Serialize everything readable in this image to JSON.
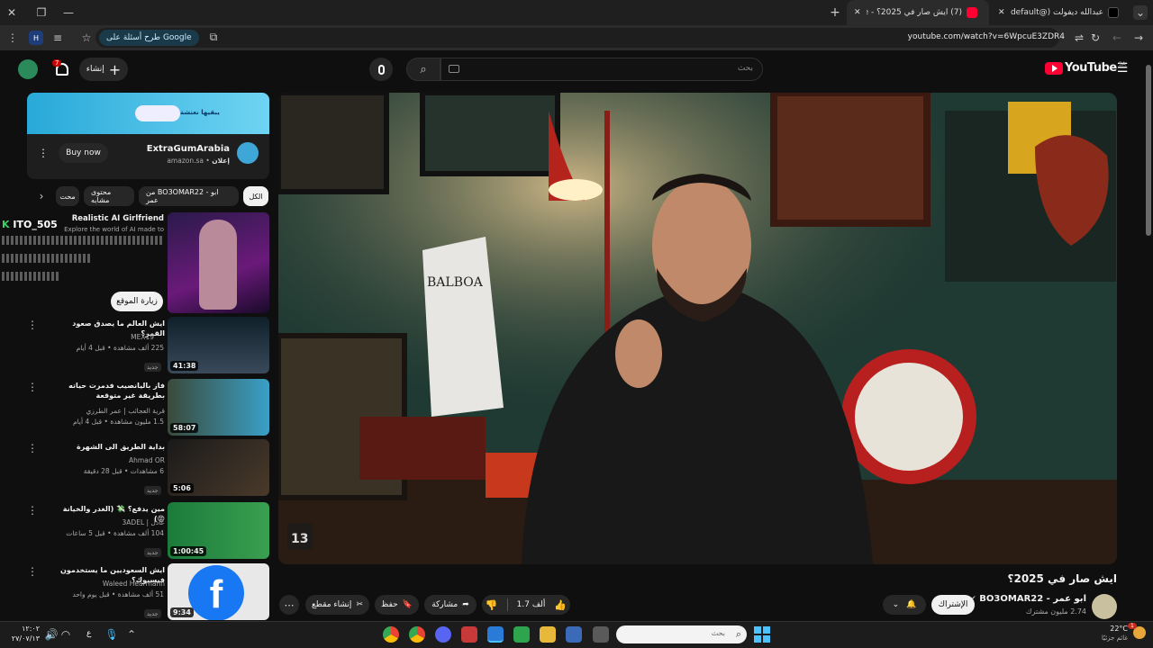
{
  "browser": {
    "tabs": [
      {
        "label": "عبدالله ديفولت (@llah_default"
      },
      {
        "label": "(7) ايش صار في 2025؟ - YouTube"
      }
    ],
    "new_tab": "+",
    "url": "youtube.com/watch?v=6WpcuE3ZDR4",
    "ask_google": "طرح أسئلة على Google",
    "profile_letter": "H"
  },
  "yt": {
    "logo_text": "YouTube",
    "logo_region": "SA",
    "search_placeholder": "بحث",
    "create_label": "إنشاء",
    "notif_count": "7"
  },
  "ad": {
    "brand": "ExtraGumArabia",
    "domain": "amazon.sa",
    "ad_label": "إعلان",
    "buy_label": "Buy now",
    "banner_text": "يبقيها نعنشة"
  },
  "chips": [
    "الكل",
    "من BO3OMAR22 - ابو عمر",
    "محتوى مشابه",
    "محت"
  ],
  "promo": {
    "title": "Realistic AI Girlfriend",
    "desc": "Explore the world of AI made to",
    "code": "ITO_505",
    "visit": "زيارة الموقع"
  },
  "videos": [
    {
      "title": "ايش العالم ما يصدق صعود القمر؟",
      "channel": "MEX19",
      "meta": "225 ألف مشاهدة • قبل 4 أيام",
      "badge": "جديد",
      "duration": "41:38"
    },
    {
      "title": "فاز باليانصيب فدمرت حياته بطريقة غير متوقعة",
      "channel": "قرية العجائب | عمر الطرزي",
      "meta": "1.5 مليون مشاهدة • قبل 4 أيام",
      "badge": "",
      "duration": "58:07"
    },
    {
      "title": "بداية الطريق الى الشهرة",
      "channel": "Ahmad OR",
      "meta": "6 مشاهدات • قبل 28 دقيقة",
      "badge": "جديد",
      "duration": "5:06"
    },
    {
      "title": "مين يدفع؟ 💸 (الغدر والخيانة 😡)",
      "channel": "عادل | 3ADEL",
      "meta": "104 ألف مشاهدة • قبل 5 ساعات",
      "badge": "جديد",
      "duration": "1:00:45"
    },
    {
      "title": "ايش السعوديين ما يستخدمون فيسبوك؟",
      "channel": "Waleed Hearmann",
      "meta": "51 ألف مشاهدة • قبل يوم واحد",
      "badge": "جديد",
      "duration": "9:34"
    }
  ],
  "watch": {
    "title": "ايش صار في 2025؟",
    "channel": "ابو عمر - BO3OMAR22",
    "subs": "2.74 مليون مشترك",
    "subscribe": "الإشتراك",
    "likes": "1.7 ألف",
    "share": "مشاركة",
    "save": "حفظ",
    "clip": "إنشاء مقطع",
    "poster_text": "BALBOA"
  },
  "taskbar": {
    "weather_temp": "22°C",
    "weather_desc": "غائم جزئيًا",
    "search_placeholder": "بحث",
    "time": "١٢:٠٢",
    "date": "٢٧/٠٧/١٣",
    "lang": "ع",
    "notif_badge": "1"
  },
  "colors": {
    "yt_red": "#ff0033",
    "accent_blue": "#3ea6ff",
    "ad_banner": "#2fb8e6"
  }
}
